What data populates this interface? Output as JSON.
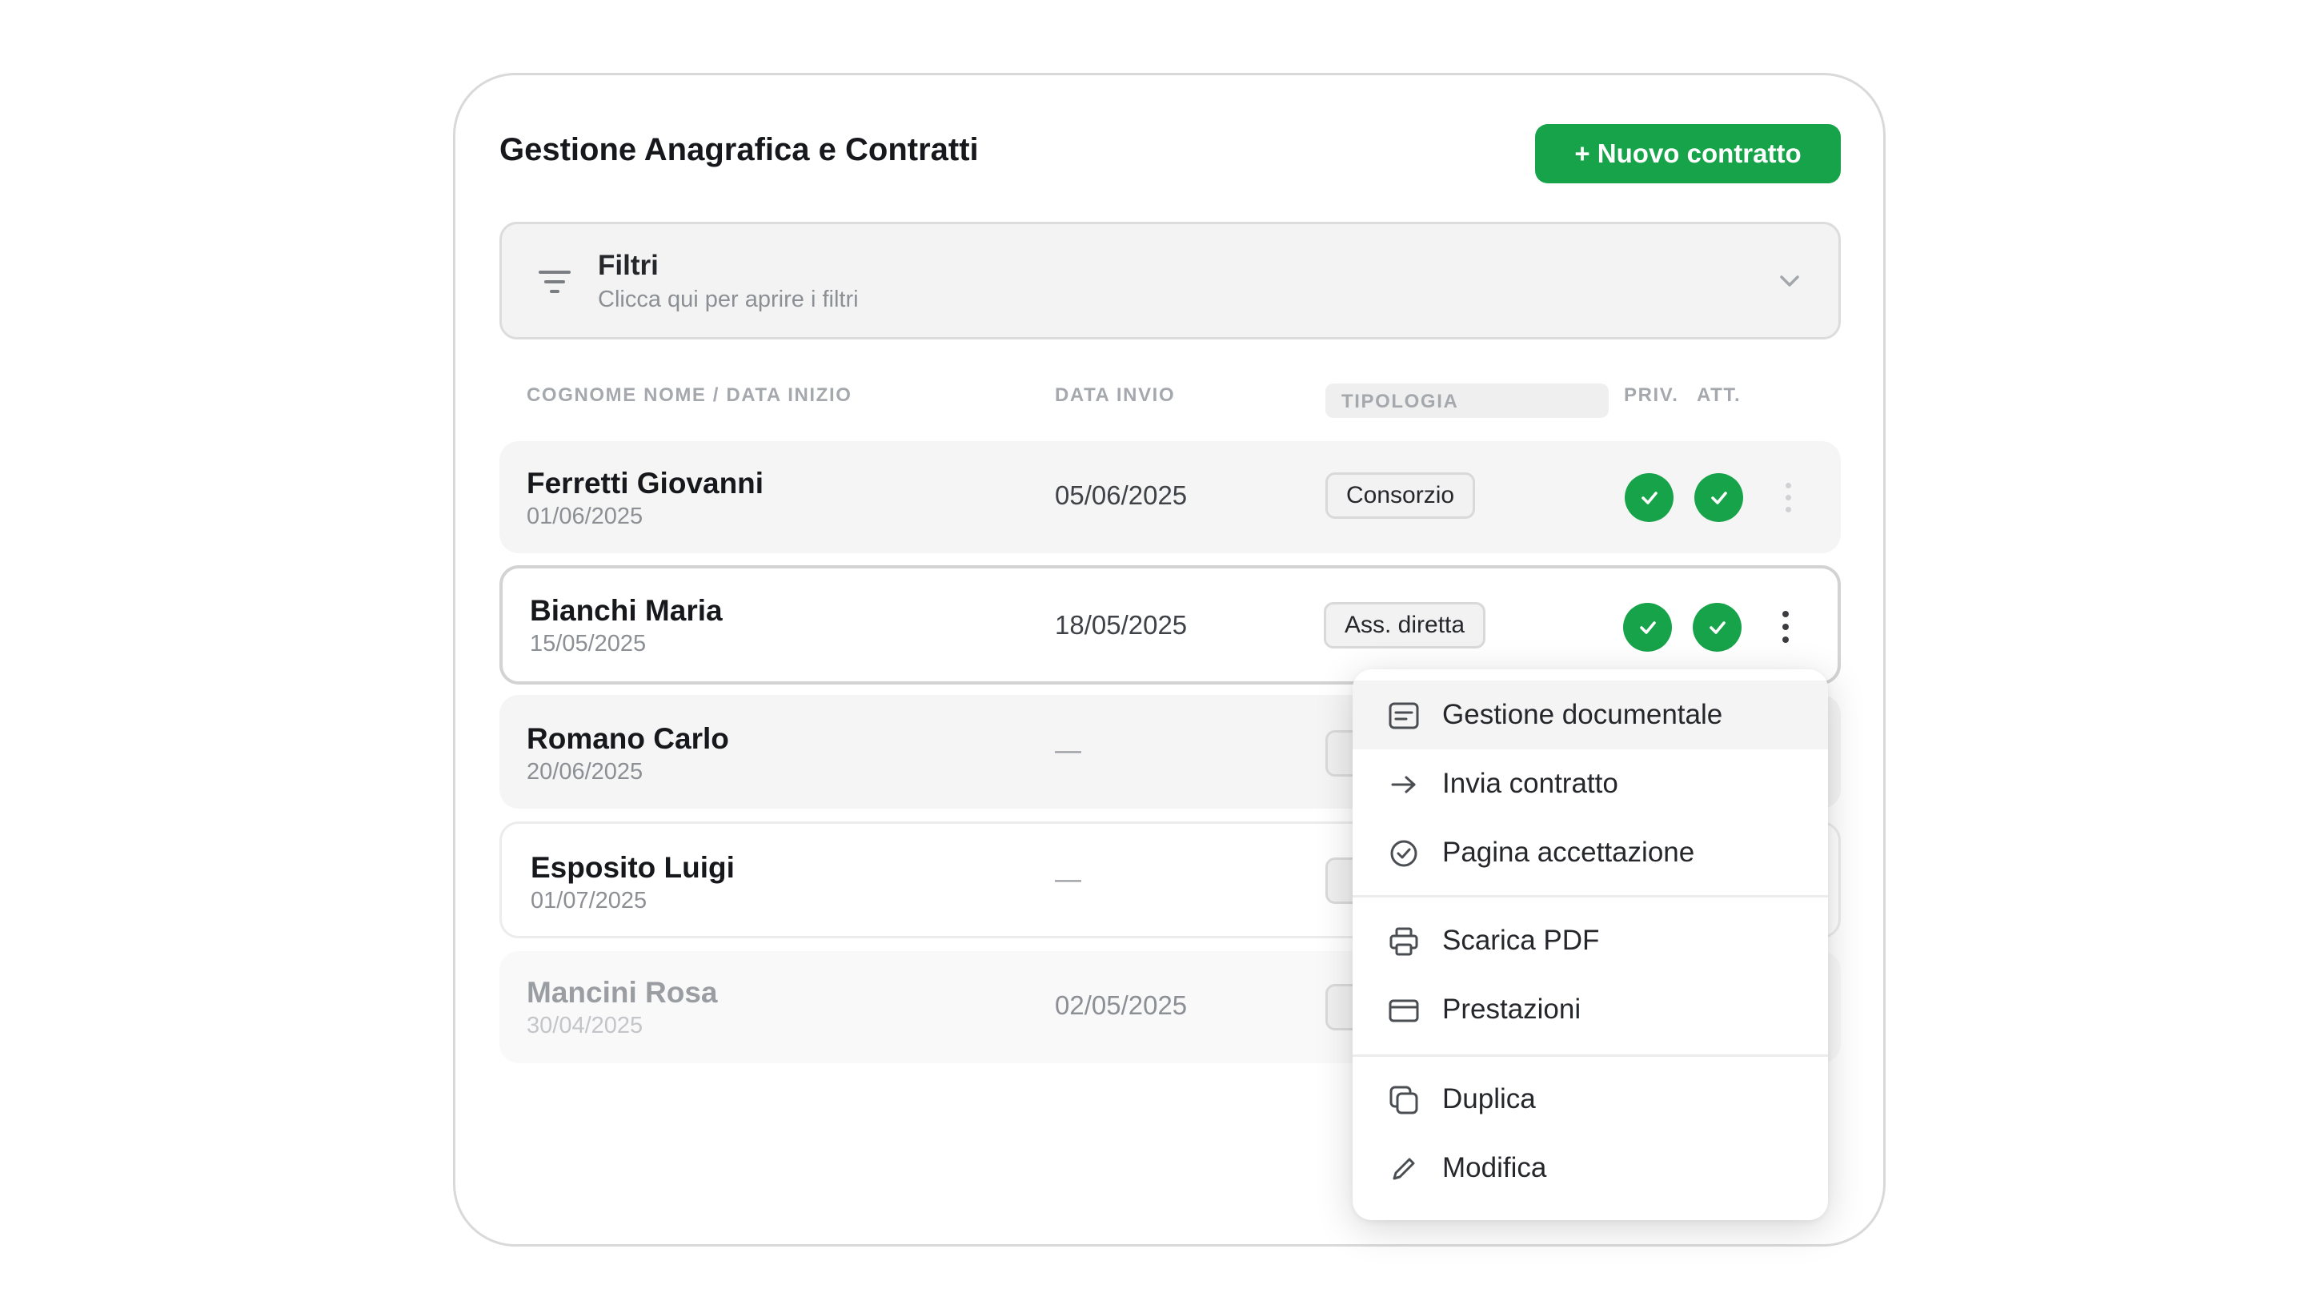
{
  "header": {
    "title": "Gestione Anagrafica e Contratti",
    "new_button": "+ Nuovo contratto"
  },
  "filters": {
    "title": "Filtri",
    "subtitle": "Clicca qui per aprire i filtri",
    "icon": "filter-icon",
    "expand_icon": "chevron-down-icon"
  },
  "table": {
    "columns": {
      "name": "COGNOME NOME / DATA INIZIO",
      "sent": "DATA INVIO",
      "type": "TIPOLOGIA",
      "priv": "PRIV.",
      "att": "ATT."
    },
    "rows": [
      {
        "name": "Ferretti Giovanni",
        "start": "01/06/2025",
        "sent": "05/06/2025",
        "type": "Consorzio",
        "priv": true,
        "att": true
      },
      {
        "name": "Bianchi Maria",
        "start": "15/05/2025",
        "sent": "18/05/2025",
        "type": "Ass. diretta",
        "priv": true,
        "att": true
      },
      {
        "name": "Romano Carlo",
        "start": "20/06/2025",
        "sent": "—"
      },
      {
        "name": "Esposito Luigi",
        "start": "01/07/2025",
        "sent": "—"
      },
      {
        "name": "Mancini Rosa",
        "start": "30/04/2025",
        "sent": "02/05/2025"
      }
    ]
  },
  "context_menu": {
    "items": [
      {
        "label": "Gestione documentale",
        "icon": "document-icon"
      },
      {
        "label": "Invia contratto",
        "icon": "arrow-right-icon"
      },
      {
        "label": "Pagina accettazione",
        "icon": "check-circle-icon"
      },
      {
        "label": "Scarica PDF",
        "icon": "printer-icon"
      },
      {
        "label": "Prestazioni",
        "icon": "card-icon"
      },
      {
        "label": "Duplica",
        "icon": "duplicate-icon"
      },
      {
        "label": "Modifica",
        "icon": "pencil-icon"
      }
    ]
  },
  "colors": {
    "accent": "#17a34a",
    "background": "#ffffff",
    "row_bg": "#f5f5f5"
  }
}
